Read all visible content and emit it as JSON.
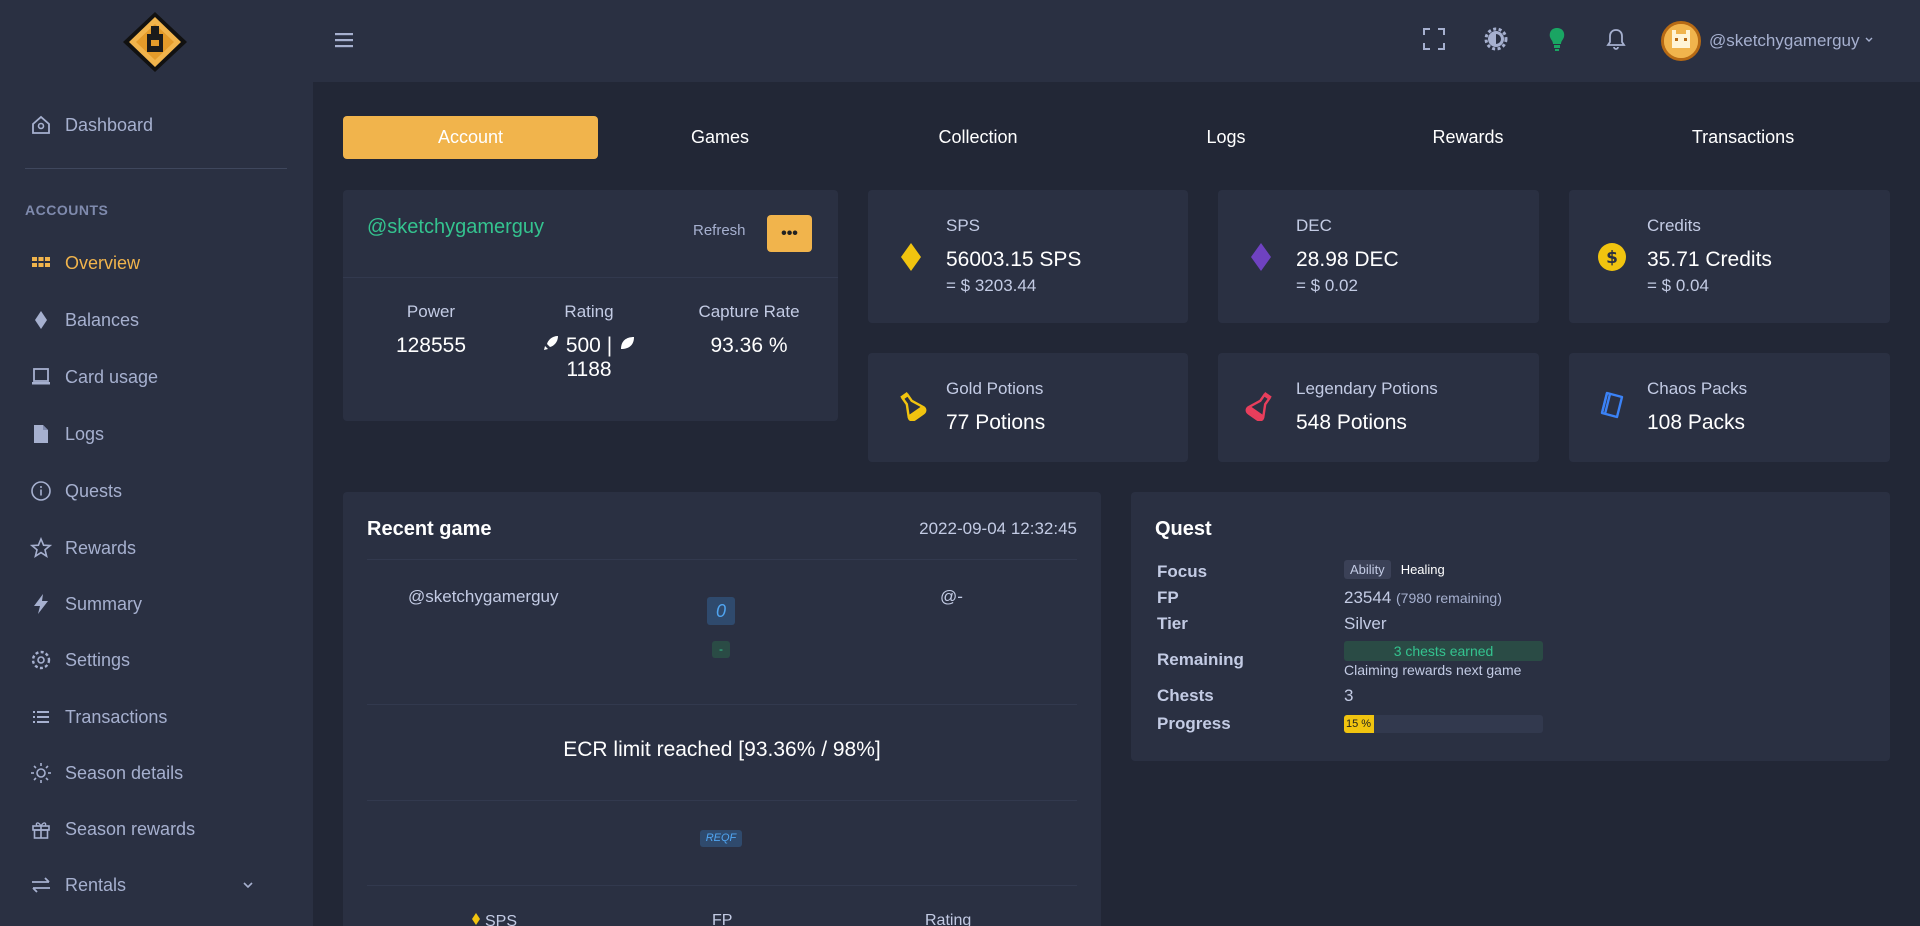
{
  "sidebar": {
    "items": [
      {
        "label": "Dashboard"
      },
      {
        "label": "Overview"
      },
      {
        "label": "Balances"
      },
      {
        "label": "Card usage"
      },
      {
        "label": "Logs"
      },
      {
        "label": "Quests"
      },
      {
        "label": "Rewards"
      },
      {
        "label": "Summary"
      },
      {
        "label": "Settings"
      },
      {
        "label": "Transactions"
      },
      {
        "label": "Season details"
      },
      {
        "label": "Season rewards"
      },
      {
        "label": "Rentals"
      }
    ],
    "section_label": "ACCOUNTS",
    "active_color": "#f1b44c"
  },
  "topbar": {
    "username": "@sketchygamerguy",
    "icons": [
      "menu-icon",
      "fullscreen-icon",
      "theme-gear-icon",
      "lightbulb-icon",
      "bell-icon"
    ]
  },
  "tabs": [
    {
      "label": "Account",
      "active": true
    },
    {
      "label": "Games"
    },
    {
      "label": "Collection"
    },
    {
      "label": "Logs"
    },
    {
      "label": "Rewards"
    },
    {
      "label": "Transactions"
    }
  ],
  "account": {
    "name": "@sketchygamerguy",
    "refresh_label": "Refresh",
    "more_label": "•••",
    "power_label": "Power",
    "power_value": "128555",
    "rating_label": "Rating",
    "rating_modern": "500 |",
    "rating_wild": "1188",
    "capture_label": "Capture Rate",
    "capture_value": "93.36 %"
  },
  "balances": [
    {
      "label": "SPS",
      "value": "56003.15 SPS",
      "usd": "= $ 3203.44",
      "icon": "sps-diamond-icon",
      "color": "#f1b44c"
    },
    {
      "label": "DEC",
      "value": "28.98 DEC",
      "usd": "= $ 0.02",
      "icon": "dec-diamond-icon",
      "color": "#6f42c1"
    },
    {
      "label": "Credits",
      "value": "35.71 Credits",
      "usd": "= $ 0.04",
      "icon": "credits-coin-icon",
      "color": "#f1c40f"
    },
    {
      "label": "Gold Potions",
      "value": "77 Potions",
      "icon": "gold-potion-icon",
      "color": "#f1c40f"
    },
    {
      "label": "Legendary Potions",
      "value": "548 Potions",
      "icon": "legendary-potion-icon",
      "color": "#e83e5c"
    },
    {
      "label": "Chaos Packs",
      "value": "108 Packs",
      "icon": "chaos-pack-icon",
      "color": "#3b82f6"
    }
  ],
  "recent_game": {
    "title": "Recent game",
    "date": "2022-09-04 12:32:45",
    "player": "@sketchygamerguy",
    "opponent": "@-",
    "score": "0",
    "result": "-",
    "message": "ECR limit reached [93.36% / 98%]",
    "tag": "REQF",
    "col_sps": "SPS",
    "col_fp": "FP",
    "col_rating": "Rating"
  },
  "quest": {
    "title": "Quest",
    "focus_label": "Focus",
    "focus_tag": "Ability",
    "focus_value": "Healing",
    "fp_label": "FP",
    "fp_value": "23544",
    "fp_remaining": "(7980 remaining)",
    "tier_label": "Tier",
    "tier_value": "Silver",
    "remaining_label": "Remaining",
    "remaining_badge": "3 chests earned",
    "remaining_note": "Claiming rewards next game",
    "chests_label": "Chests",
    "chests_value": "3",
    "progress_label": "Progress",
    "progress_text": "15 %",
    "progress_value": 15
  }
}
